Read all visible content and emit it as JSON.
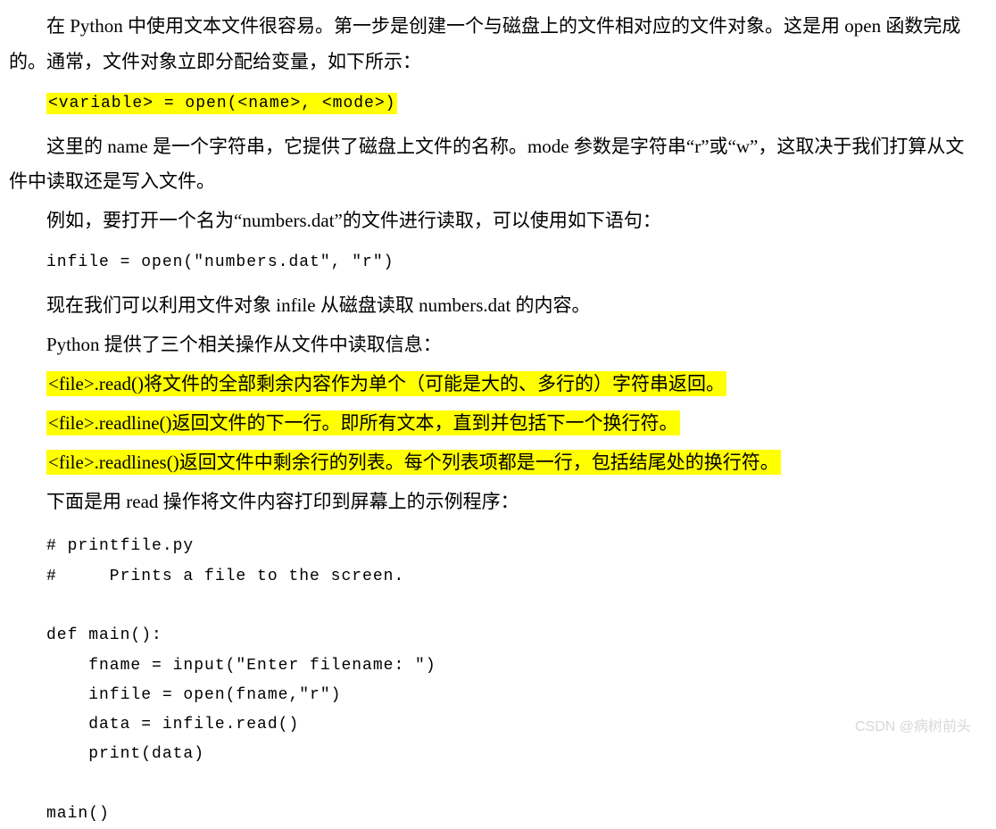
{
  "p1": "在 Python 中使用文本文件很容易。第一步是创建一个与磁盘上的文件相对应的文件对象。这是用 open 函数完成的。通常，文件对象立即分配给变量，如下所示：",
  "code1": "<variable> = open(<name>, <mode>)",
  "p2": "这里的 name 是一个字符串，它提供了磁盘上文件的名称。mode 参数是字符串“r”或“w”，这取决于我们打算从文件中读取还是写入文件。",
  "p3": "例如，要打开一个名为“numbers.dat”的文件进行读取，可以使用如下语句：",
  "code2": "infile = open(\"numbers.dat\", \"r\")",
  "p4": "现在我们可以利用文件对象 infile 从磁盘读取 numbers.dat 的内容。",
  "p5": "Python 提供了三个相关操作从文件中读取信息：",
  "h1": "<file>.read()将文件的全部剩余内容作为单个（可能是大的、多行的）字符串返回。",
  "h2": "<file>.readline()返回文件的下一行。即所有文本，直到并包括下一个换行符。",
  "h3": "<file>.readlines()返回文件中剩余行的列表。每个列表项都是一行，包括结尾处的换行符。",
  "p6": "下面是用 read 操作将文件内容打印到屏幕上的示例程序：",
  "code3": "# printfile.py\n#     Prints a file to the screen.\n\ndef main():\n    fname = input(\"Enter filename: \")\n    infile = open(fname,\"r\")\n    data = infile.read()\n    print(data)\n\nmain()",
  "watermark": "CSDN @病树前头"
}
